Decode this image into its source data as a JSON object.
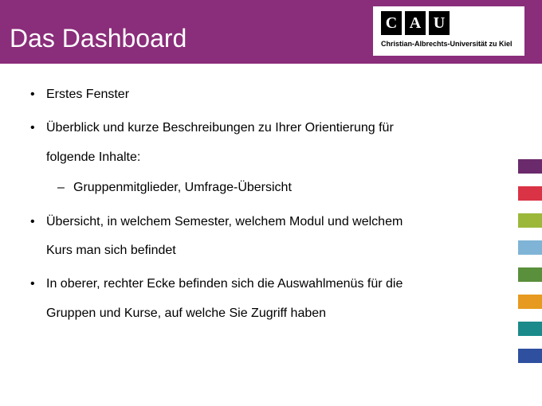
{
  "header": {
    "title": "Das Dashboard"
  },
  "logo": {
    "c": "C",
    "a": "A",
    "u": "U",
    "subtitle": "Christian-Albrechts-Universität zu Kiel"
  },
  "bullets": {
    "b1": "Erstes Fenster",
    "b2_line1": "Überblick und kurze Beschreibungen zu Ihrer Orientierung für",
    "b2_line2": "folgende Inhalte:",
    "b2_sub1": "Gruppenmitglieder, Umfrage-Übersicht",
    "b3_line1": "Übersicht, in welchem Semester, welchem Modul und welchem",
    "b3_line2": "Kurs man sich befindet",
    "b4_line1": "In oberer, rechter Ecke befinden sich die Auswahlmenüs für die",
    "b4_line2": "Gruppen und Kurse, auf welche Sie Zugriff haben"
  },
  "tab_colors": [
    "#6b2a6b",
    "#d93345",
    "#9bb83a",
    "#7fb4d6",
    "#5a8f3c",
    "#e69a1f",
    "#1a8a8a",
    "#2f4f9f"
  ]
}
